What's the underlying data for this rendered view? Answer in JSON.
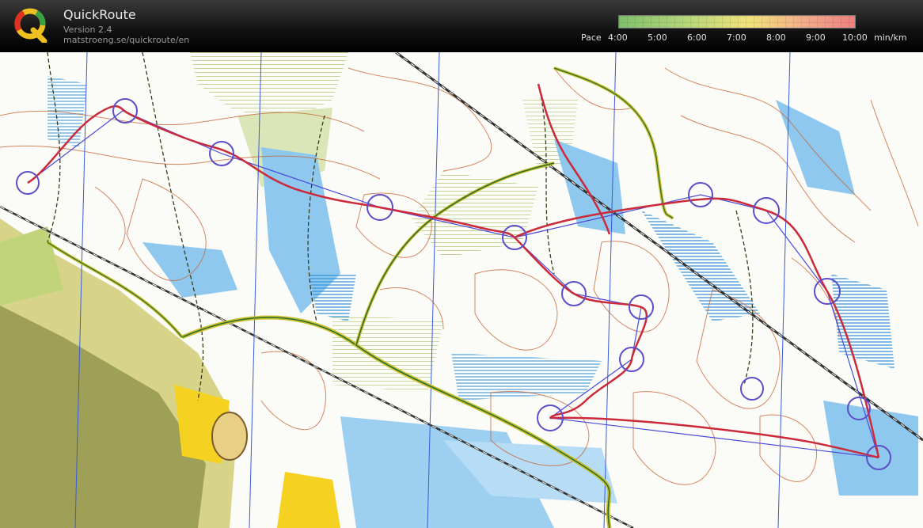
{
  "app": {
    "name": "QuickRoute",
    "version": "Version 2.4",
    "url": "matstroeng.se/quickroute/en"
  },
  "pace_scale": {
    "label": "Pace",
    "ticks": [
      "4:00",
      "5:00",
      "6:00",
      "7:00",
      "8:00",
      "9:00",
      "10:00"
    ],
    "unit": "min/km"
  },
  "colors": {
    "route": "#cc2a3a",
    "control_circle": "#5a4fc8",
    "water": "#3aa0e0",
    "vegetation": "#c2d47a",
    "contour": "#c8602e",
    "urban": "#f5d222"
  }
}
